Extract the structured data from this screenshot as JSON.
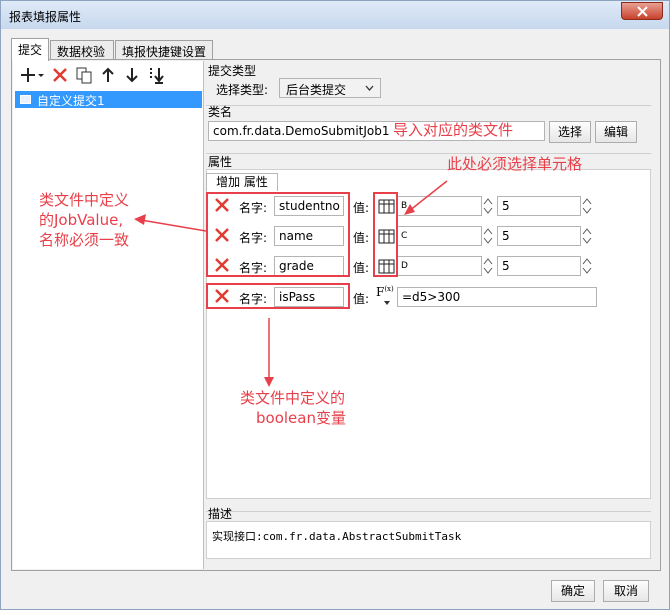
{
  "window": {
    "title": "报表填报属性"
  },
  "tabs": [
    {
      "label": "提交"
    },
    {
      "label": "数据校验"
    },
    {
      "label": "填报快捷键设置"
    }
  ],
  "list": {
    "items": [
      {
        "label": "自定义提交1"
      }
    ]
  },
  "submit_type": {
    "section_label": "提交类型",
    "select_label": "选择类型:",
    "selected": "后台类提交"
  },
  "class_name": {
    "section_label": "类名",
    "value": "com.fr.data.DemoSubmitJob1",
    "select_button": "选择",
    "edit_button": "编辑"
  },
  "properties": {
    "section_label": "属性",
    "add_label": "增加 属性",
    "name_label": "名字:",
    "value_label": "值:",
    "rows": [
      {
        "name": "studentno",
        "cell": "B",
        "value": "5"
      },
      {
        "name": "name",
        "cell": "C",
        "value": "5"
      },
      {
        "name": "grade",
        "cell": "D",
        "value": "5"
      }
    ],
    "formula_row": {
      "name": "isPass",
      "icon_label": "F",
      "icon_sub": "(x)",
      "value": "=d5>300"
    }
  },
  "description": {
    "section_label": "描述",
    "text": "实现接口:com.fr.data.AbstractSubmitTask"
  },
  "buttons": {
    "ok": "确定",
    "cancel": "取消"
  },
  "annotations": {
    "import_class": "导入对应的类文件",
    "select_cell": "此处必须选择单元格",
    "job_value_1": "类文件中定义",
    "job_value_2": "的JobValue,",
    "job_value_3": "名称必须一致",
    "boolean_1": "类文件中定义的",
    "boolean_2": "boolean变量"
  },
  "colors": {
    "annotation": "#e8404a",
    "selection": "#3399ff",
    "delete_icon": "#e03c31"
  }
}
